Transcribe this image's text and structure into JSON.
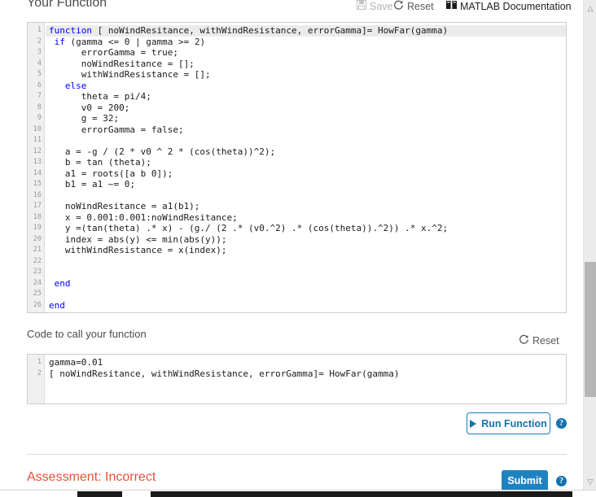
{
  "header": {
    "title": "Your Function",
    "save_label": "Save",
    "save_icon": "floppy-disk-icon",
    "reset_label": "Reset",
    "reset_icon": "refresh-icon",
    "docs_label": "MATLAB Documentation",
    "docs_icon": "book-icon"
  },
  "editor": {
    "lines": [
      {
        "n": "1",
        "text": "function [ noWindResitance, withWindResistance, errorGamma]= HowFar(gamma)",
        "kw": "function",
        "highlight": true
      },
      {
        "n": "2",
        "text": " if (gamma <= 0 | gamma >= 2)",
        "kw": "if"
      },
      {
        "n": "3",
        "text": "      errorGamma = true;"
      },
      {
        "n": "4",
        "text": "      noWindResitance = [];"
      },
      {
        "n": "5",
        "text": "      withWindResistance = [];"
      },
      {
        "n": "6",
        "text": "   else",
        "kw": "else"
      },
      {
        "n": "7",
        "text": "      theta = pi/4;"
      },
      {
        "n": "8",
        "text": "      v0 = 200;"
      },
      {
        "n": "9",
        "text": "      g = 32;"
      },
      {
        "n": "10",
        "text": "      errorGamma = false;"
      },
      {
        "n": "11",
        "text": ""
      },
      {
        "n": "12",
        "text": "   a = -g / (2 * v0 ^ 2 * (cos(theta))^2);"
      },
      {
        "n": "13",
        "text": "   b = tan (theta);"
      },
      {
        "n": "14",
        "text": "   a1 = roots([a b 0]);"
      },
      {
        "n": "15",
        "text": "   b1 = a1 ~= 0;"
      },
      {
        "n": "16",
        "text": ""
      },
      {
        "n": "17",
        "text": "   noWindResitance = a1(b1);"
      },
      {
        "n": "18",
        "text": "   x = 0.001:0.001:noWindResitance;"
      },
      {
        "n": "19",
        "text": "   y =(tan(theta) .* x) - (g./ (2 .* (v0.^2) .* (cos(theta)).^2)) .* x.^2;"
      },
      {
        "n": "20",
        "text": "   index = abs(y) <= min(abs(y));"
      },
      {
        "n": "21",
        "text": "   withWindResistance = x(index);"
      },
      {
        "n": "22",
        "text": ""
      },
      {
        "n": "23",
        "text": ""
      },
      {
        "n": "24",
        "text": " end",
        "kw": "end"
      },
      {
        "n": "25",
        "text": ""
      },
      {
        "n": "26",
        "text": "end",
        "kw": "end"
      }
    ]
  },
  "call_section": {
    "label": "Code to call your function",
    "reset_label": "Reset",
    "reset_icon": "refresh-icon",
    "lines": [
      {
        "n": "1",
        "text": "gamma=0.01"
      },
      {
        "n": "2",
        "text": "[ noWindResitance, withWindResistance, errorGamma]= HowFar(gamma)"
      }
    ]
  },
  "actions": {
    "run_label": "Run Function",
    "run_icon": "play-icon",
    "run_help_icon": "question-mark-icon",
    "submit_label": "Submit",
    "submit_help_icon": "question-mark-icon"
  },
  "assessment": {
    "text": "Assessment: Incorrect",
    "color": "#e8503a"
  },
  "scrollbars": {
    "vertical_up_icon": "chevron-up-icon",
    "vertical_down_icon": "chevron-down-icon"
  }
}
